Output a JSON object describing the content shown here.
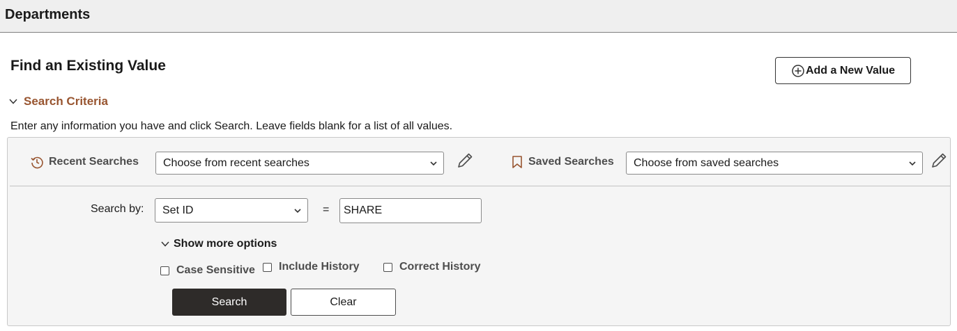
{
  "header": {
    "title": "Departments"
  },
  "main": {
    "title": "Find an Existing Value",
    "add_button_label": "Add a New Value",
    "criteria_label": "Search Criteria",
    "instructions": "Enter any information you have and click Search. Leave fields blank for a list of all values."
  },
  "recent": {
    "label": "Recent Searches",
    "select_value": "Choose from recent searches"
  },
  "saved": {
    "label": "Saved Searches",
    "select_value": "Choose from saved searches"
  },
  "search_by": {
    "label": "Search by:",
    "field_value": "Set ID",
    "operator": "=",
    "input_value": "SHARE"
  },
  "options": {
    "toggle_label": "Show more options",
    "case_sensitive": "Case Sensitive",
    "include_history": "Include History",
    "correct_history": "Correct History"
  },
  "buttons": {
    "search": "Search",
    "clear": "Clear"
  },
  "colors": {
    "accent": "#985530",
    "primary_button": "#2e2b29",
    "panel_bg": "#f5f5f5"
  },
  "icons": {
    "add": "circle-plus-icon",
    "collapse": "chevron-down-icon",
    "recent": "history-icon",
    "saved": "bookmark-icon",
    "edit": "pencil-icon",
    "dropdown": "caret-down-icon"
  }
}
